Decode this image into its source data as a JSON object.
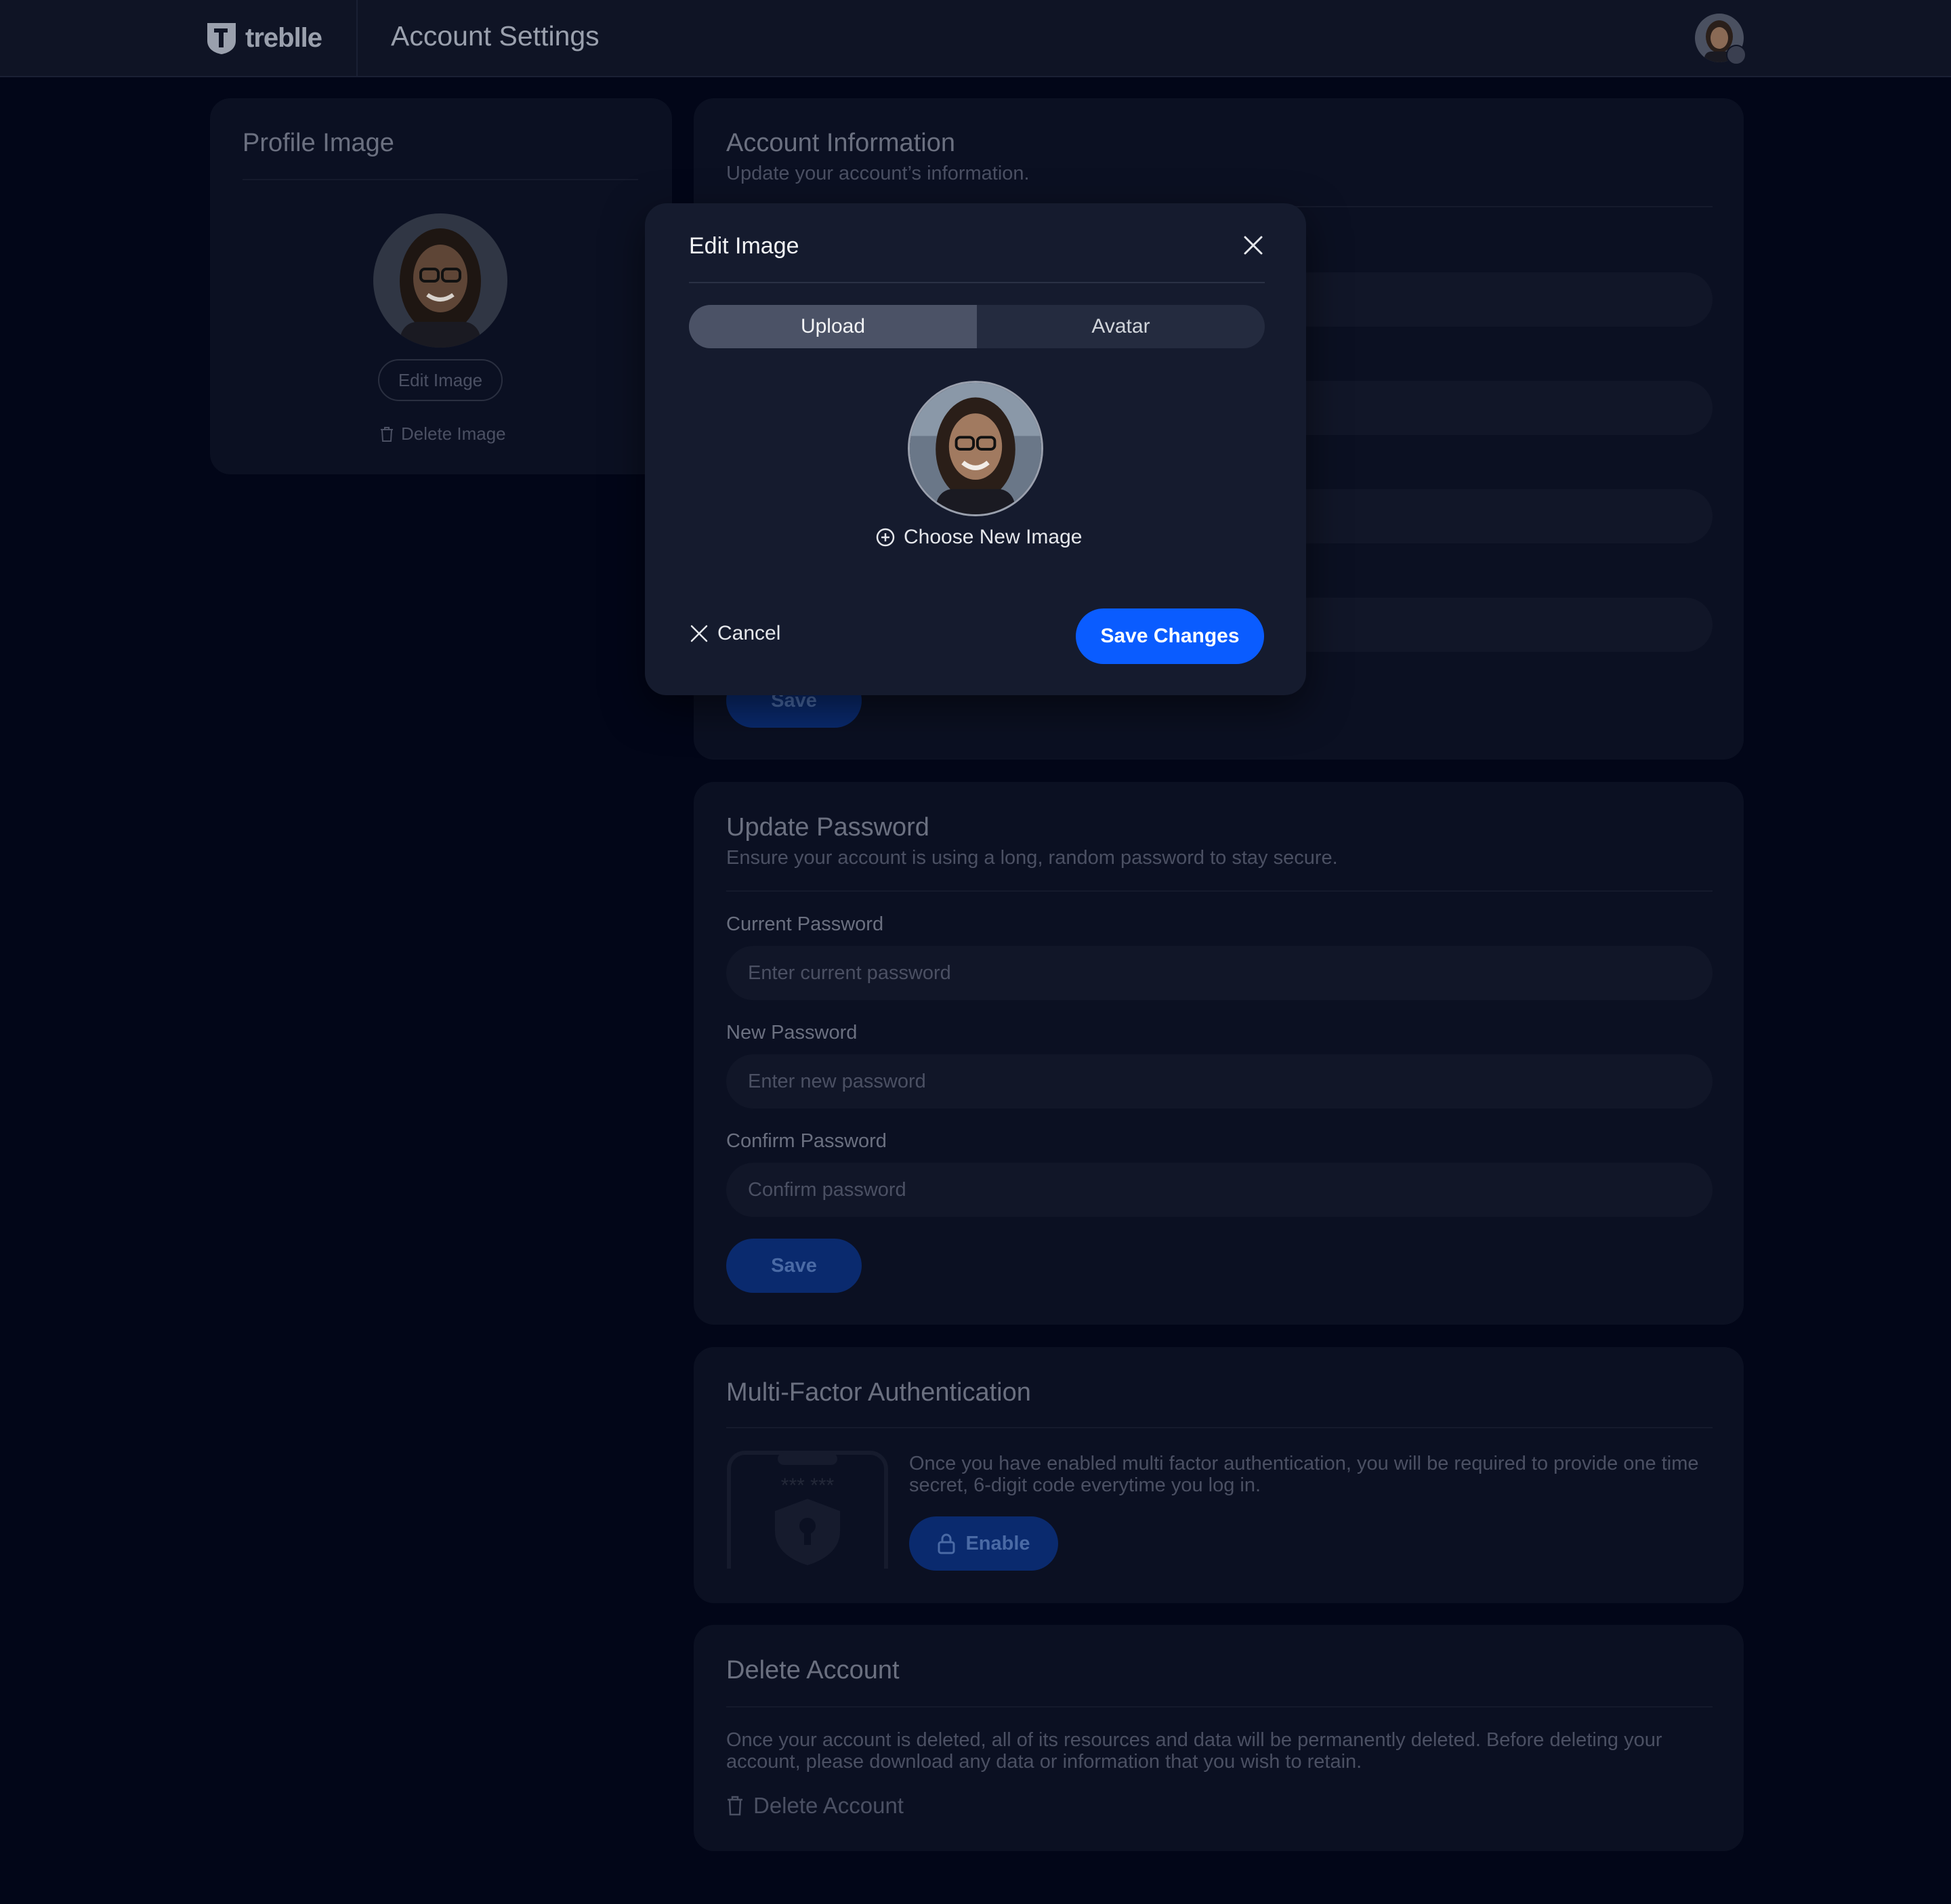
{
  "header": {
    "brand": "treblle",
    "title": "Account Settings",
    "avatar_icon": "user-avatar"
  },
  "profile_card": {
    "title": "Profile Image",
    "edit_button": "Edit Image",
    "delete_link": "Delete Image"
  },
  "account_info": {
    "title": "Account Information",
    "subtitle": "Update your account’s information.",
    "save_label": "Save"
  },
  "update_password": {
    "title": "Update Password",
    "subtitle": "Ensure your account is using a long, random password to stay secure.",
    "fields": [
      {
        "label": "Current Password",
        "placeholder": "Enter current password"
      },
      {
        "label": "New Password",
        "placeholder": "Enter new password"
      },
      {
        "label": "Confirm Password",
        "placeholder": "Confirm password"
      }
    ],
    "save_label": "Save"
  },
  "mfa": {
    "title": "Multi-Factor Authentication",
    "description": "Once you have enabled multi factor authentication, you will be required to provide one time secret, 6-digit code everytime you log in.",
    "illustration_text": "*** ***",
    "enable_label": "Enable"
  },
  "delete_account": {
    "title": "Delete Account",
    "description": "Once your account is deleted, all of its resources and data will be permanently deleted. Before deleting your account, please download any data or information that you wish to retain.",
    "link_label": "Delete Account"
  },
  "modal": {
    "title": "Edit Image",
    "tabs": [
      {
        "label": "Upload",
        "active": true
      },
      {
        "label": "Avatar",
        "active": false
      }
    ],
    "choose_label": "Choose New Image",
    "cancel_label": "Cancel",
    "save_label": "Save Changes"
  },
  "colors": {
    "background": "#020618",
    "card": "#0b1022",
    "modal": "#151b2e",
    "primary": "#0a5cff"
  }
}
